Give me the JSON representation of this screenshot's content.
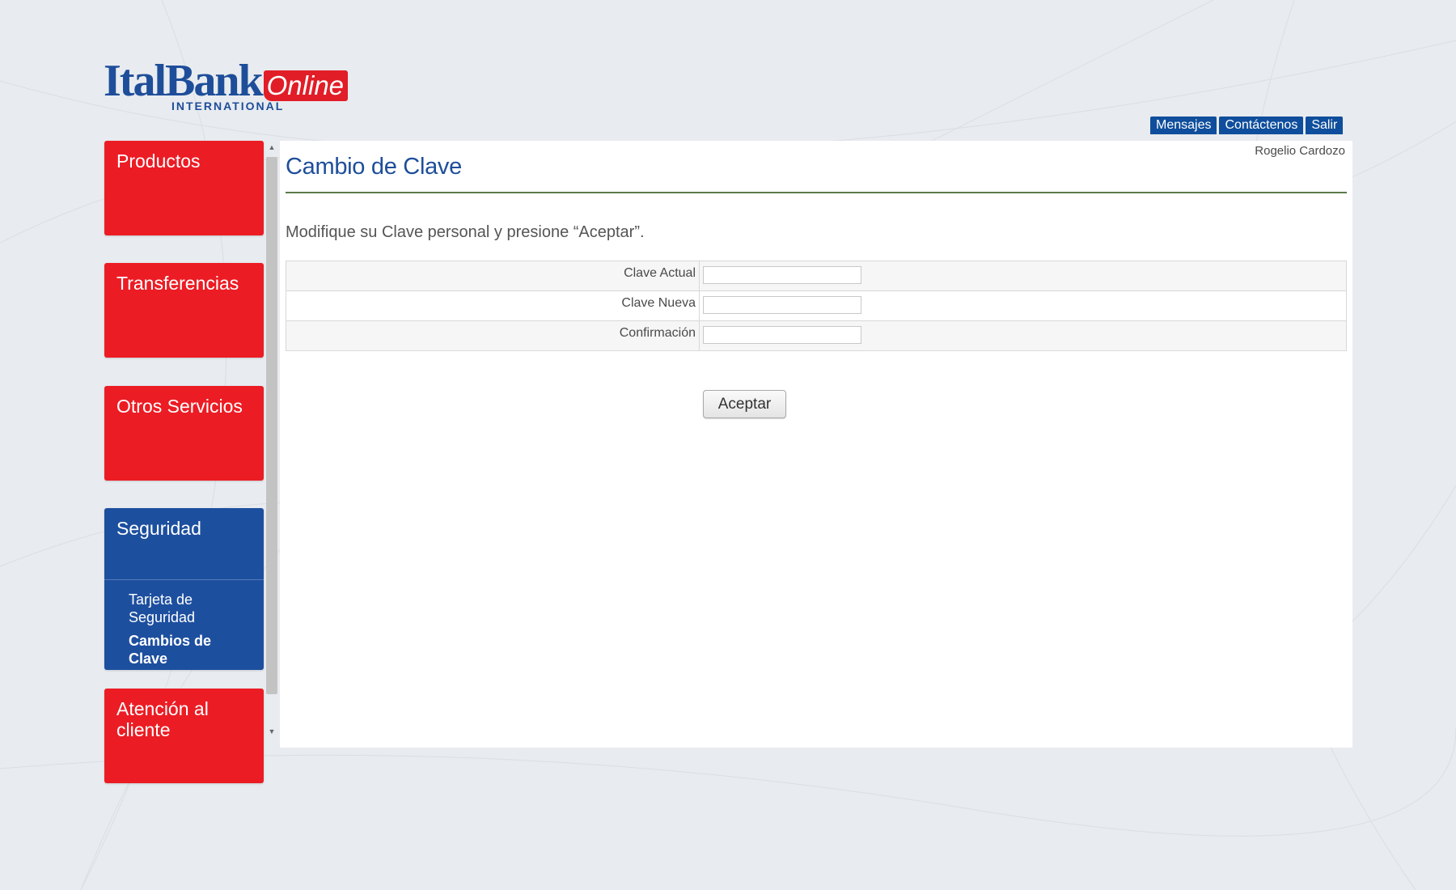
{
  "brand": {
    "name": "ItalBank",
    "online_badge": "Online",
    "subtitle": "INTERNATIONAL"
  },
  "top_links": [
    "Mensajes",
    "Contáctenos",
    "Salir"
  ],
  "sidebar": {
    "items": [
      {
        "label": "Productos"
      },
      {
        "label": "Transferencias"
      },
      {
        "label": "Otros Servicios"
      },
      {
        "label": "Seguridad",
        "active": true,
        "subitems": [
          {
            "label": "Tarjeta de Seguridad",
            "current": false
          },
          {
            "label": "Cambios de Clave",
            "current": true
          }
        ]
      },
      {
        "label": "Atención al cliente"
      }
    ]
  },
  "main": {
    "user_name": "Rogelio Cardozo",
    "title": "Cambio de Clave",
    "instructions": "Modifique su Clave personal y presione “Aceptar”.",
    "fields": [
      {
        "label": "Clave Actual",
        "value": ""
      },
      {
        "label": "Clave Nueva",
        "value": ""
      },
      {
        "label": "Confirmación",
        "value": ""
      }
    ],
    "submit_label": "Aceptar"
  },
  "colors": {
    "brand_blue": "#1e4e9a",
    "brand_red": "#ec1c24",
    "link_blue": "#0f4e9c",
    "active_blue": "#1d4f9f"
  }
}
